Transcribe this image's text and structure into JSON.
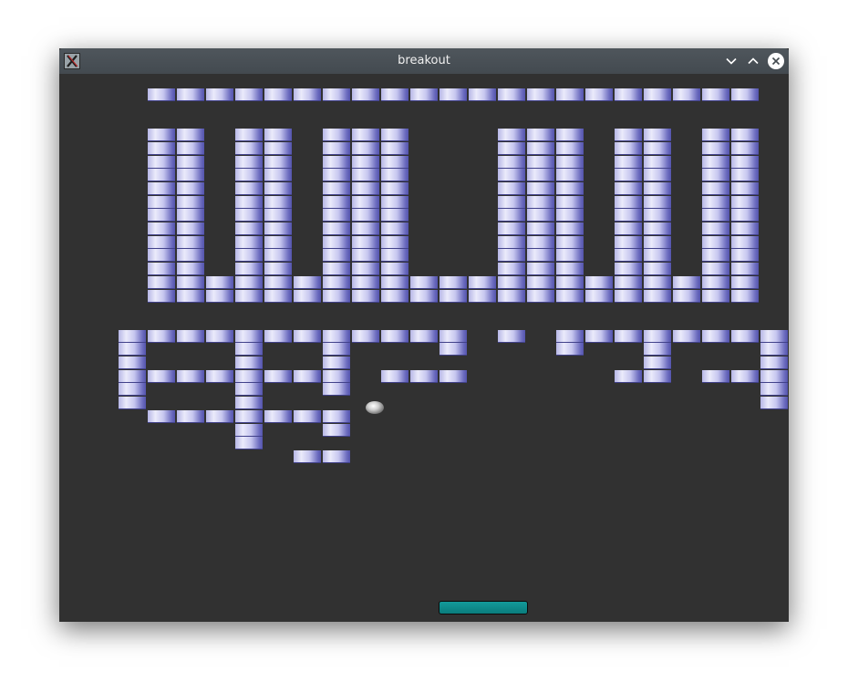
{
  "window": {
    "title": "breakout",
    "icons": {
      "app": "x-app-icon",
      "minimize": "chevron-down-icon",
      "maximize": "chevron-up-icon",
      "close": "close-icon"
    }
  },
  "game": {
    "brick_colors": [
      "#ebebfb",
      "#6c6cbf"
    ],
    "ball_color": "#cfcfcf",
    "paddle_color": "#139a9a"
  }
}
